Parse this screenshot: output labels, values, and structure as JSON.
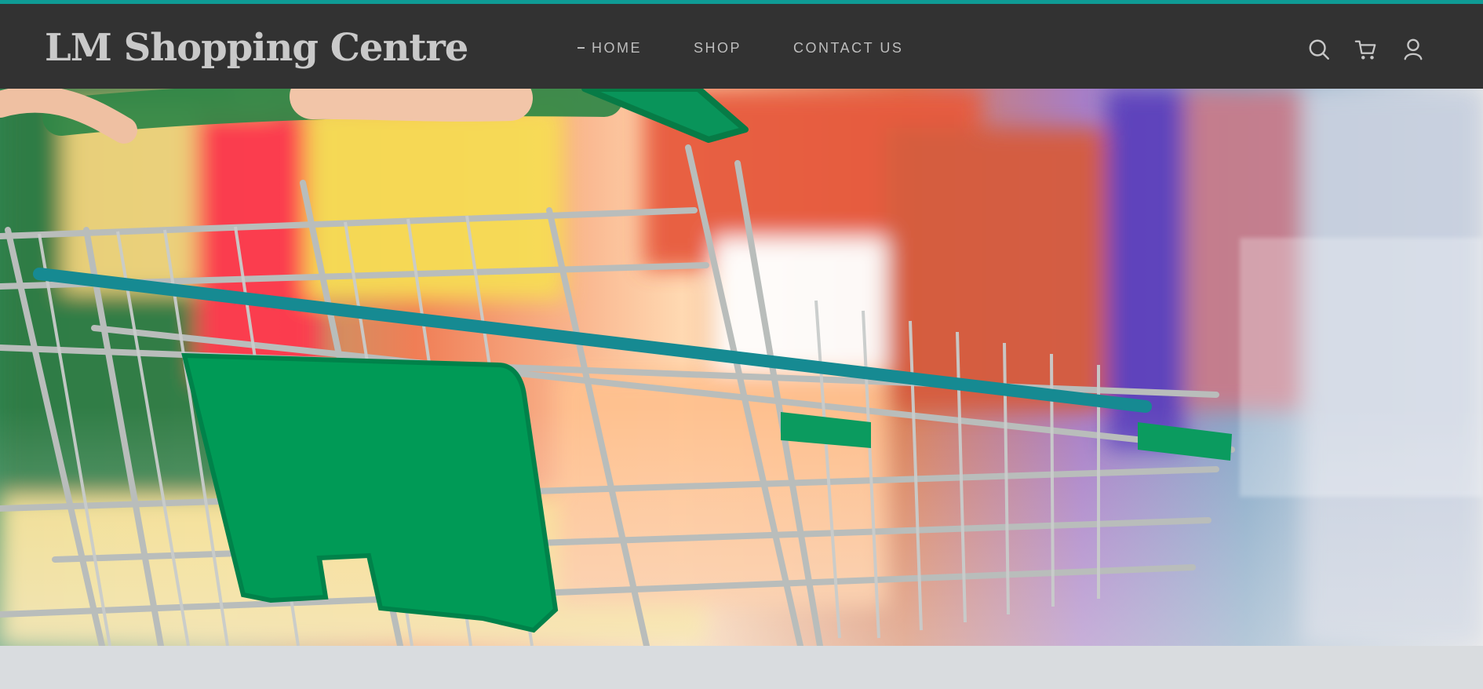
{
  "site": {
    "title": "LM Shopping Centre"
  },
  "nav": {
    "items": [
      {
        "label": "HOME",
        "active": true
      },
      {
        "label": "SHOP",
        "active": false
      },
      {
        "label": "CONTACT US",
        "active": false
      }
    ]
  },
  "header_icons": [
    {
      "name": "search-icon"
    },
    {
      "name": "cart-icon"
    },
    {
      "name": "user-icon"
    }
  ],
  "hero": {
    "image_alt": "",
    "image_name": "shopping-cart-in-supermarket"
  },
  "colors": {
    "accent": "#0f9b95",
    "header_background": "#323232",
    "header_text": "#c9c9c9",
    "bottom_band": "#d9dcdf"
  }
}
